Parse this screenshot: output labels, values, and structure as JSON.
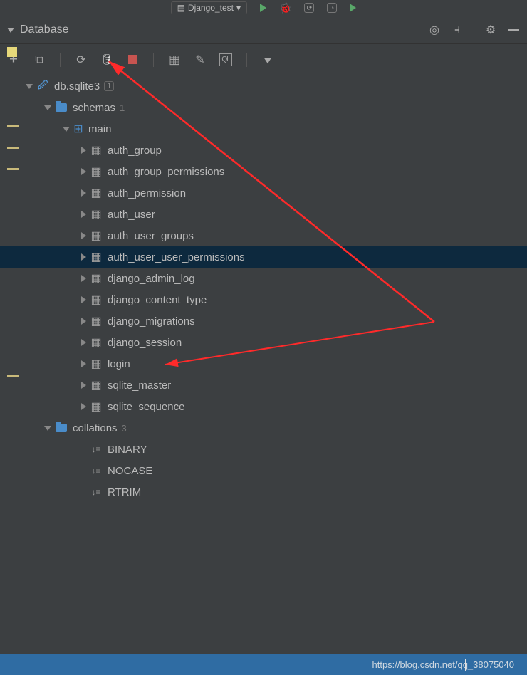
{
  "topbar": {
    "config_name": "Django_test"
  },
  "panel": {
    "title": "Database"
  },
  "tree": {
    "db_name": "db.sqlite3",
    "db_badge": "1",
    "schemas_label": "schemas",
    "schemas_count": "1",
    "main_label": "main",
    "tables": [
      "auth_group",
      "auth_group_permissions",
      "auth_permission",
      "auth_user",
      "auth_user_groups",
      "auth_user_user_permissions",
      "django_admin_log",
      "django_content_type",
      "django_migrations",
      "django_session",
      "login",
      "sqlite_master",
      "sqlite_sequence"
    ],
    "selected_index": 5,
    "collations_label": "collations",
    "collations_count": "3",
    "collations": [
      "BINARY",
      "NOCASE",
      "RTRIM"
    ]
  },
  "footer": {
    "text": "https://blog.csdn.net/qq_38075040"
  }
}
